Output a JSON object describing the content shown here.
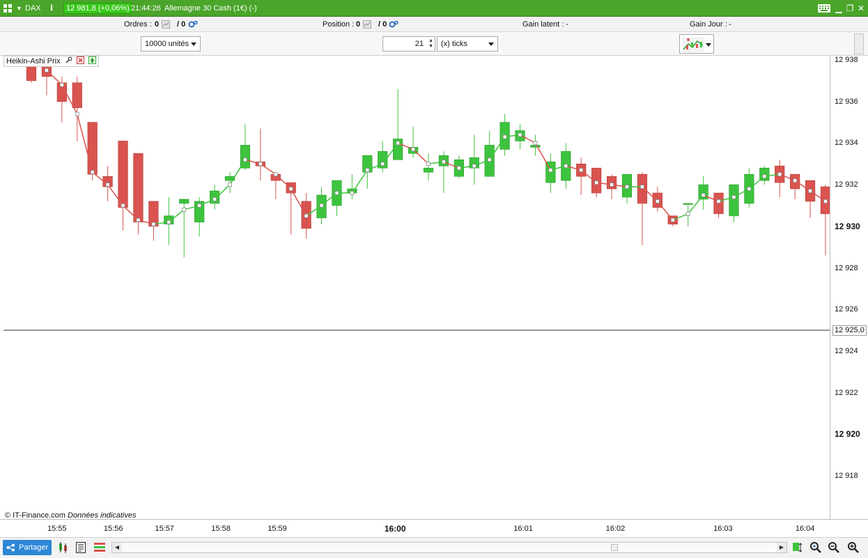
{
  "titlebar": {
    "menu_icon": "grid-icon",
    "symbol": "DAX",
    "info_icon": "info-icon",
    "price_badge": "12 981,8 (+0,06%)",
    "time": "21:44:26",
    "instrument": "Allemagne 30 Cash (1€) (-)",
    "window_buttons": [
      "keyboard-icon",
      "minimize-icon",
      "restore-icon",
      "close-icon"
    ]
  },
  "infobar": {
    "orders_label": "Ordres :",
    "orders_value1": "0",
    "orders_value2": "/ 0",
    "position_label": "Position :",
    "position_value1": "0",
    "position_value2": "/ 0",
    "gain_latent_label": "Gain latent :",
    "gain_latent_value": "-",
    "gain_jour_label": "Gain Jour :",
    "gain_jour_value": "-"
  },
  "toolbar": {
    "quantity": "10000 unités",
    "tick_count": "21",
    "tick_unit": "(x) ticks",
    "chart_type_icon": "candlestick-chart-icon"
  },
  "indicator": {
    "label": "Heikin-Ashi Prix",
    "icons": [
      "wrench-icon",
      "close-red-icon",
      "arrow-up-green-icon"
    ]
  },
  "credit": {
    "source": "© IT-Finance.com",
    "note": "Données indicatives"
  },
  "bottombar": {
    "share_label": "Partager",
    "share_icon": "share-icon",
    "tools": [
      "sheet-icon",
      "indicators-icon"
    ],
    "zoom_icons": [
      "zoom-fit-icon",
      "zoom-range-icon",
      "zoom-out-icon",
      "zoom-in-icon"
    ]
  },
  "colors": {
    "up": "#3dc33d",
    "down": "#d9534f",
    "titlebar": "#4aa52a",
    "price_badge": "#38c81a"
  },
  "chart_data": {
    "type": "candlestick",
    "style": "Heikin-Ashi",
    "ylim": [
      12916,
      12939
    ],
    "yticks": [
      12918,
      12920,
      12922,
      12924,
      12926,
      12928,
      12930,
      12932,
      12934,
      12936,
      12938
    ],
    "ytick_labels": [
      "12 918",
      "12 920",
      "12 922",
      "12 924",
      "12 926",
      "12 928",
      "12 930",
      "12 932",
      "12 934",
      "12 936",
      "12 938"
    ],
    "ytick_bold": [
      12920,
      12930
    ],
    "current_price": 12925.0,
    "current_price_label": "12 925,0",
    "xticks": [
      {
        "label": "15:55",
        "bar": 5,
        "bold": false
      },
      {
        "label": "15:56",
        "bar": 16,
        "bold": false
      },
      {
        "label": "15:57",
        "bar": 26,
        "bold": false
      },
      {
        "label": "15:58",
        "bar": 37,
        "bold": false
      },
      {
        "label": "15:59",
        "bar": 48,
        "bold": false
      },
      {
        "label": "16:00",
        "bar": 71,
        "bold": true
      },
      {
        "label": "16:01",
        "bar": 96,
        "bold": false
      },
      {
        "label": "16:02",
        "bar": 114,
        "bold": false
      },
      {
        "label": "16:03",
        "bar": 135,
        "bold": false
      },
      {
        "label": "16:04",
        "bar": 151,
        "bold": false
      }
    ],
    "candles": [
      [
        12939.2,
        12937.0,
        12939.4,
        12936.9
      ],
      [
        12937.7,
        12937.2,
        12938.4,
        12936.3
      ],
      [
        12936.9,
        12936.0,
        12937.2,
        12935.0
      ],
      [
        12936.9,
        12935.7,
        12937.2,
        12934.1
      ],
      [
        12935.0,
        12932.5,
        12935.0,
        12932.2
      ],
      [
        12932.4,
        12931.9,
        12932.9,
        12931.2
      ],
      [
        12934.1,
        12930.9,
        12934.1,
        12929.8
      ],
      [
        12933.5,
        12930.2,
        12933.5,
        12929.6
      ],
      [
        12931.2,
        12930.0,
        12931.2,
        12929.3
      ],
      [
        12930.1,
        12930.5,
        12931.4,
        12929.1
      ],
      [
        12931.1,
        12931.3,
        12931.3,
        12928.5
      ],
      [
        12930.2,
        12931.2,
        12931.4,
        12929.5
      ],
      [
        12931.1,
        12931.7,
        12932.0,
        12930.8
      ],
      [
        12932.2,
        12932.4,
        12932.6,
        12931.6
      ],
      [
        12932.8,
        12933.9,
        12934.9,
        12932.7
      ],
      [
        12933.1,
        12932.9,
        12934.7,
        12932.2
      ],
      [
        12932.5,
        12932.2,
        12932.6,
        12931.3
      ],
      [
        12932.1,
        12931.6,
        12932.1,
        12929.6
      ],
      [
        12931.2,
        12929.9,
        12931.6,
        12929.4
      ],
      [
        12930.4,
        12931.5,
        12931.9,
        12930.1
      ],
      [
        12931.0,
        12932.2,
        12932.2,
        12930.5
      ],
      [
        12931.6,
        12931.8,
        12932.5,
        12931.3
      ],
      [
        12932.6,
        12933.4,
        12933.4,
        12931.8
      ],
      [
        12932.8,
        12933.6,
        12934.1,
        12932.6
      ],
      [
        12933.2,
        12934.2,
        12936.6,
        12933.4
      ],
      [
        12933.5,
        12933.8,
        12934.8,
        12933.3
      ],
      [
        12932.6,
        12932.8,
        12933.5,
        12932.2
      ],
      [
        12932.9,
        12933.4,
        12933.6,
        12931.6
      ],
      [
        12932.4,
        12933.2,
        12933.4,
        12932.3
      ],
      [
        12932.8,
        12933.3,
        12934.4,
        12932.0
      ],
      [
        12932.4,
        12933.9,
        12934.6,
        12932.4
      ],
      [
        12933.7,
        12935.0,
        12935.4,
        12933.4
      ],
      [
        12934.1,
        12934.6,
        12934.9,
        12933.7
      ],
      [
        12933.8,
        12933.9,
        12934.4,
        12933.4
      ],
      [
        12932.1,
        12933.1,
        12933.5,
        12931.6
      ],
      [
        12932.2,
        12933.6,
        12934.0,
        12931.8
      ],
      [
        12933.0,
        12932.4,
        12933.3,
        12931.5
      ],
      [
        12932.8,
        12931.6,
        12932.8,
        12931.4
      ],
      [
        12932.4,
        12931.8,
        12932.5,
        12931.3
      ],
      [
        12931.4,
        12932.5,
        12932.5,
        12931.1
      ],
      [
        12932.5,
        12931.1,
        12932.6,
        12929.1
      ],
      [
        12931.6,
        12930.9,
        12931.9,
        12930.7
      ],
      [
        12930.5,
        12930.1,
        12930.5,
        12930.0
      ],
      [
        12931.1,
        12931.1,
        12931.1,
        12930.0
      ],
      [
        12931.3,
        12932.0,
        12932.4,
        12930.8
      ],
      [
        12931.6,
        12930.6,
        12931.6,
        12930.4
      ],
      [
        12930.5,
        12932.0,
        12932.0,
        12930.2
      ],
      [
        12931.1,
        12932.5,
        12932.8,
        12930.9
      ],
      [
        12932.2,
        12932.8,
        12932.9,
        12932.0
      ],
      [
        12932.9,
        12932.1,
        12933.2,
        12931.4
      ],
      [
        12932.5,
        12931.8,
        12932.5,
        12931.3
      ],
      [
        12932.2,
        12931.2,
        12932.2,
        12930.4
      ],
      [
        12931.9,
        12930.6,
        12932.0,
        12928.6
      ]
    ],
    "line_points": [
      [
        0,
        12938.7
      ],
      [
        1,
        12937.5
      ],
      [
        2,
        12936.8
      ],
      [
        3,
        12935.4
      ],
      [
        4,
        12932.6
      ],
      [
        5,
        12932.0
      ],
      [
        6,
        12931.0
      ],
      [
        7,
        12930.3
      ],
      [
        8,
        12930.1
      ],
      [
        9,
        12930.2
      ],
      [
        10,
        12930.8
      ],
      [
        11,
        12931.0
      ],
      [
        12,
        12931.3
      ],
      [
        13,
        12932.0
      ],
      [
        14,
        12933.2
      ],
      [
        15,
        12933.0
      ],
      [
        16,
        12932.5
      ],
      [
        17,
        12931.8
      ],
      [
        18,
        12930.5
      ],
      [
        19,
        12931.0
      ],
      [
        20,
        12931.6
      ],
      [
        21,
        12931.6
      ],
      [
        22,
        12932.7
      ],
      [
        23,
        12933.0
      ],
      [
        24,
        12934.0
      ],
      [
        25,
        12933.7
      ],
      [
        26,
        12933.0
      ],
      [
        27,
        12933.1
      ],
      [
        28,
        12932.8
      ],
      [
        29,
        12932.9
      ],
      [
        30,
        12933.2
      ],
      [
        31,
        12934.3
      ],
      [
        32,
        12934.4
      ],
      [
        33,
        12934.0
      ],
      [
        34,
        12932.7
      ],
      [
        35,
        12932.9
      ],
      [
        36,
        12932.7
      ],
      [
        37,
        12932.1
      ],
      [
        38,
        12932.0
      ],
      [
        39,
        12931.9
      ],
      [
        40,
        12931.9
      ],
      [
        41,
        12931.2
      ],
      [
        42,
        12930.3
      ],
      [
        43,
        12930.6
      ],
      [
        44,
        12931.5
      ],
      [
        45,
        12931.2
      ],
      [
        46,
        12931.4
      ],
      [
        47,
        12931.8
      ],
      [
        48,
        12932.4
      ],
      [
        49,
        12932.5
      ],
      [
        50,
        12932.2
      ],
      [
        51,
        12931.7
      ],
      [
        52,
        12931.2
      ]
    ]
  }
}
